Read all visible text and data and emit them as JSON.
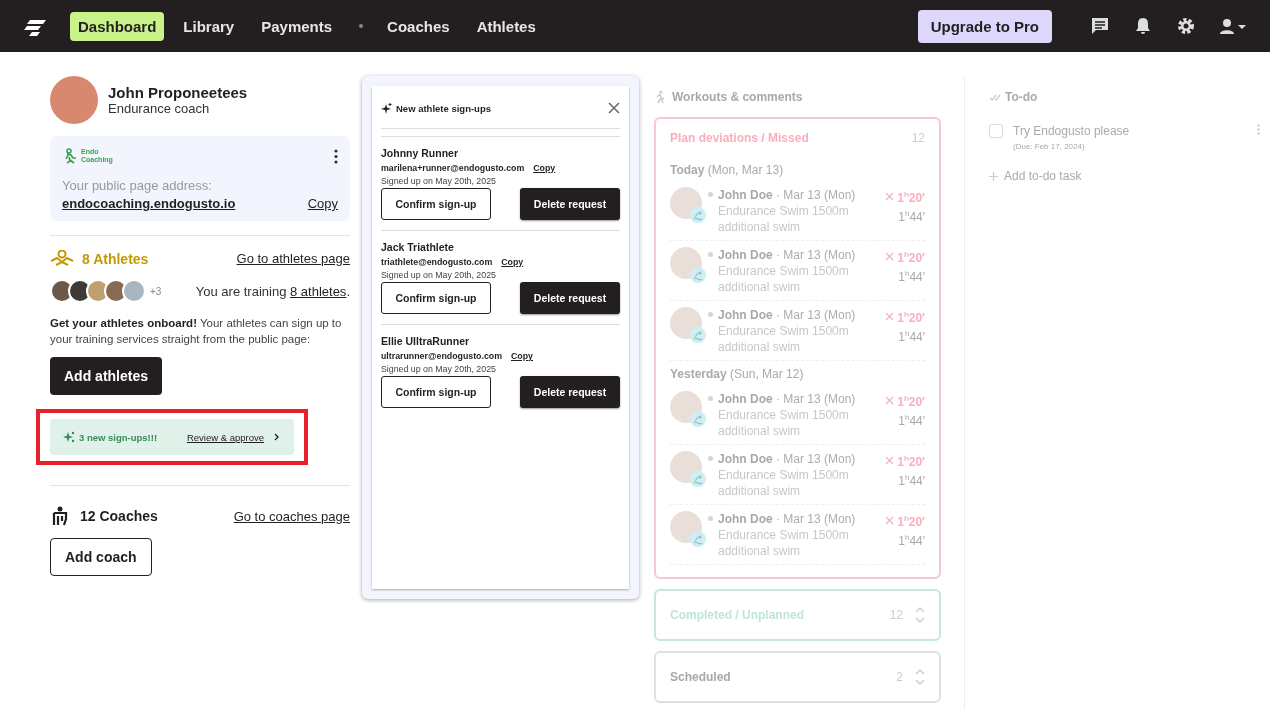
{
  "nav": {
    "items": [
      {
        "kind": "tab",
        "label": "Dashboard",
        "selected": true
      },
      {
        "kind": "tab",
        "label": "Library",
        "selected": false
      },
      {
        "kind": "tab",
        "label": "Payments",
        "selected": false
      },
      {
        "kind": "separator"
      },
      {
        "kind": "tab",
        "label": "Coaches",
        "selected": false
      },
      {
        "kind": "tab",
        "label": "Athletes",
        "selected": false
      }
    ],
    "upgrade": "Upgrade to Pro"
  },
  "coach": {
    "name": "John Proponeetees",
    "role": "Endurance coach",
    "public_page": {
      "logo_lines": [
        "Endo",
        "Coaching"
      ],
      "label": "Your public page address:",
      "address": "endocoaching.endogusto.io",
      "copy": "Copy"
    },
    "athletes": {
      "title": "8 Athletes",
      "link": "Go to athletes page",
      "more": "+3",
      "training_prefix": "You are training ",
      "training_link": "8 athletes",
      "training_suffix": ".",
      "onboard": "**Get your athletes onboard!** Your athletes can sign up to your training services straight from the public page:",
      "button": "Add athletes",
      "banner": {
        "text": "3 new sign-ups!!!",
        "link": "Review & approve",
        "highlighted": true
      }
    },
    "coaches": {
      "title": "12 Coaches",
      "link": "Go to coaches page",
      "button": "Add coach"
    }
  },
  "signups": {
    "title": "New athlete sign-ups",
    "items": [
      {
        "name": "Johnny Runner",
        "email": "marilena+runner@endogusto.com",
        "copy": "Copy",
        "date": "Signed up on May 20th, 2025",
        "confirm": "Confirm sign-up",
        "delete": "Delete request"
      },
      {
        "name": "Jack Triathlete",
        "email": "triathlete@endogusto.com",
        "copy": "Copy",
        "date": "Signed up on May 20th, 2025",
        "confirm": "Confirm sign-up",
        "delete": "Delete request"
      },
      {
        "name": "Ellie UIltraRunner",
        "email": "ultrarunner@endogusto.com",
        "copy": "Copy",
        "date": "Signed up on May 20th, 2025",
        "confirm": "Confirm sign-up",
        "delete": "Delete request"
      }
    ]
  },
  "workouts": {
    "title": "Workouts & comments",
    "sections": [
      {
        "kind": "missed",
        "title": "Plan deviations / Missed",
        "count": "12",
        "expanded": true,
        "groups": [
          {
            "label": "Today",
            "date": "(Mon, Mar 13)",
            "items": [
              {
                "name": "John Doe",
                "date": "· Mar 13 (Mon)",
                "workout": "Endurance Swim 1500m",
                "note": "additional swim",
                "planned": "1$^{h}$20′",
                "actual": "1$^{h}$44′"
              },
              {
                "name": "John Doe",
                "date": "· Mar 13 (Mon)",
                "workout": "Endurance Swim 1500m",
                "note": "additional swim",
                "planned": "1$^{h}$20′",
                "actual": "1$^{h}$44′"
              },
              {
                "name": "John Doe",
                "date": "· Mar 13 (Mon)",
                "workout": "Endurance Swim 1500m",
                "note": "additional swim",
                "planned": "1$^{h}$20′",
                "actual": "1$^{h}$44′"
              }
            ]
          },
          {
            "label": "Yesterday",
            "date": "(Sun, Mar 12)",
            "items": [
              {
                "name": "John Doe",
                "date": "· Mar 13 (Mon)",
                "workout": "Endurance Swim 1500m",
                "note": "additional swim",
                "planned": "1$^{h}$20′",
                "actual": "1$^{h}$44′"
              },
              {
                "name": "John Doe",
                "date": "· Mar 13 (Mon)",
                "workout": "Endurance Swim 1500m",
                "note": "additional swim",
                "planned": "1$^{h}$20′",
                "actual": "1$^{h}$44′"
              },
              {
                "name": "John Doe",
                "date": "· Mar 13 (Mon)",
                "workout": "Endurance Swim 1500m",
                "note": "additional swim",
                "planned": "1$^{h}$20′",
                "actual": "1$^{h}$44′"
              }
            ]
          }
        ]
      },
      {
        "kind": "completed",
        "title": "Completed / Unplanned",
        "count": "12",
        "expanded": false
      },
      {
        "kind": "scheduled",
        "title": "Scheduled",
        "count": "2",
        "expanded": false
      }
    ]
  },
  "todo": {
    "title": "To-do",
    "items": [
      {
        "label": "Try Endogusto please",
        "due": "(Due: Feb 17, 2024)",
        "checked": false
      }
    ],
    "add": "Add to-do task"
  }
}
